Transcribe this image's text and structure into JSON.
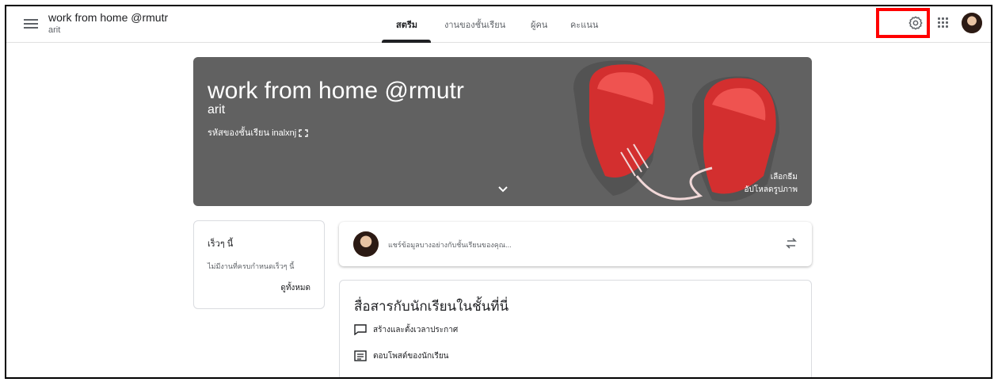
{
  "header": {
    "class_name": "work from home @rmutr",
    "class_section": "arit",
    "tabs": [
      {
        "label": "สตรีม"
      },
      {
        "label": "งานของชั้นเรียน"
      },
      {
        "label": "ผู้คน"
      },
      {
        "label": "คะแนน"
      }
    ]
  },
  "banner": {
    "title": "work from home @rmutr",
    "subtitle": "arit",
    "class_code_label": "รหัสของชั้นเรียน",
    "class_code": "inalxnj",
    "select_theme": "เลือกธีม",
    "upload_photo": "อัปโหลดรูปภาพ"
  },
  "upcoming": {
    "title": "เร็วๆ นี้",
    "none_text": "ไม่มีงานที่ครบกำหนดเร็วๆ นี้",
    "view_all": "ดูทั้งหมด"
  },
  "share": {
    "placeholder": "แชร์ข้อมูลบางอย่างกับชั้นเรียนของคุณ..."
  },
  "communicate": {
    "title": "สื่อสารกับนักเรียนในชั้นที่นี่",
    "items": [
      {
        "label": "สร้างและตั้งเวลาประกาศ",
        "icon": "announcement-icon"
      },
      {
        "label": "ตอบโพสต์ของนักเรียน",
        "icon": "post-reply-icon"
      }
    ]
  },
  "colors": {
    "highlight": "#ff0000",
    "banner_bg": "#616161",
    "glove_red": "#d32f2f"
  }
}
